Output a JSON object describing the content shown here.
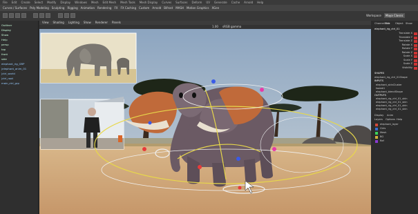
{
  "app": {
    "menu": [
      "File",
      "Edit",
      "Create",
      "Select",
      "Modify",
      "Display",
      "Windows",
      "Mesh",
      "Edit Mesh",
      "Mesh Tools",
      "Mesh Display",
      "Curves",
      "Surfaces",
      "Deform",
      "UV",
      "Generate",
      "Cache",
      "Arnold",
      "Help"
    ],
    "shelf_tabs": [
      "Curves / Surfaces",
      "Poly Modeling",
      "Sculpting",
      "Rigging",
      "Animation",
      "Rendering",
      "FX",
      "FX Caching",
      "Custom",
      "Arnold",
      "Bifrost",
      "MASH",
      "Motion Graphics",
      "XGen"
    ],
    "workspace_label": "Workspace",
    "workspace_value": "Maya Classic"
  },
  "left_panel": {
    "items": [
      "Outliner",
      "Display",
      "Show",
      "Help",
      "persp",
      "top",
      "front",
      "side",
      "elephant_rig_GRP",
      "|elephant_anim_01",
      "|ctrl_world",
      "|ctrl_root",
      "main_ctrl_grp"
    ]
  },
  "viewport": {
    "tabs": [
      "View",
      "Shading",
      "Lighting",
      "Show",
      "Renderer",
      "Panels"
    ],
    "resolution_label": "1.00",
    "colorspace": "sRGB gamma"
  },
  "right_panel": {
    "header_tabs": [
      "Channel Box",
      "Edit",
      "Object",
      "Show"
    ],
    "object_name": "elephant_rig_ctrl_01",
    "channels": [
      "Translate X",
      "Translate Y",
      "Translate Z",
      "Rotate X",
      "Rotate Y",
      "Rotate Z",
      "Scale X",
      "Scale Y",
      "Scale Z",
      "Visibility"
    ],
    "shapes_label": "SHAPES",
    "shape_name": "elephant_rig_ctrl_01Shape",
    "inputs_label": "INPUTS",
    "inputs": [
      "elephant_skinCluster",
      "tweak1",
      "elephant_blendShape"
    ],
    "outputs_label": "OUTPUTS",
    "outputs": [
      "elephant_rig_ctrl_01_skin",
      "elephant_rig_ctrl_01_skin",
      "elephant_rig_ctrl_01_skin",
      "elephant_rig_ctrl_01_skin"
    ],
    "layers_tabs": [
      "Display",
      "Anim"
    ],
    "layers_menu": [
      "Layers",
      "Options",
      "Help"
    ],
    "layers": [
      {
        "name": "elephant_layer",
        "color": "#d24a3a"
      },
      {
        "name": "Ctrls",
        "color": "#3a6fd2"
      },
      {
        "name": "Mesh",
        "color": "#3ad25a"
      },
      {
        "name": "BG",
        "color": "#d2b23a"
      },
      {
        "name": "Ref",
        "color": "#8a3ad2"
      }
    ]
  },
  "colors": {
    "sky": "#9fb2c6",
    "ground": "#d9b88a",
    "elephant": "#6b5a64",
    "ear": "#c06a3a",
    "rig_curve": "#e8d84a",
    "rig_circle": "#f0f0f0",
    "ctrl_red": "#e83a3a",
    "ctrl_blue": "#3a5ae8",
    "ctrl_pink": "#e83aa8"
  }
}
